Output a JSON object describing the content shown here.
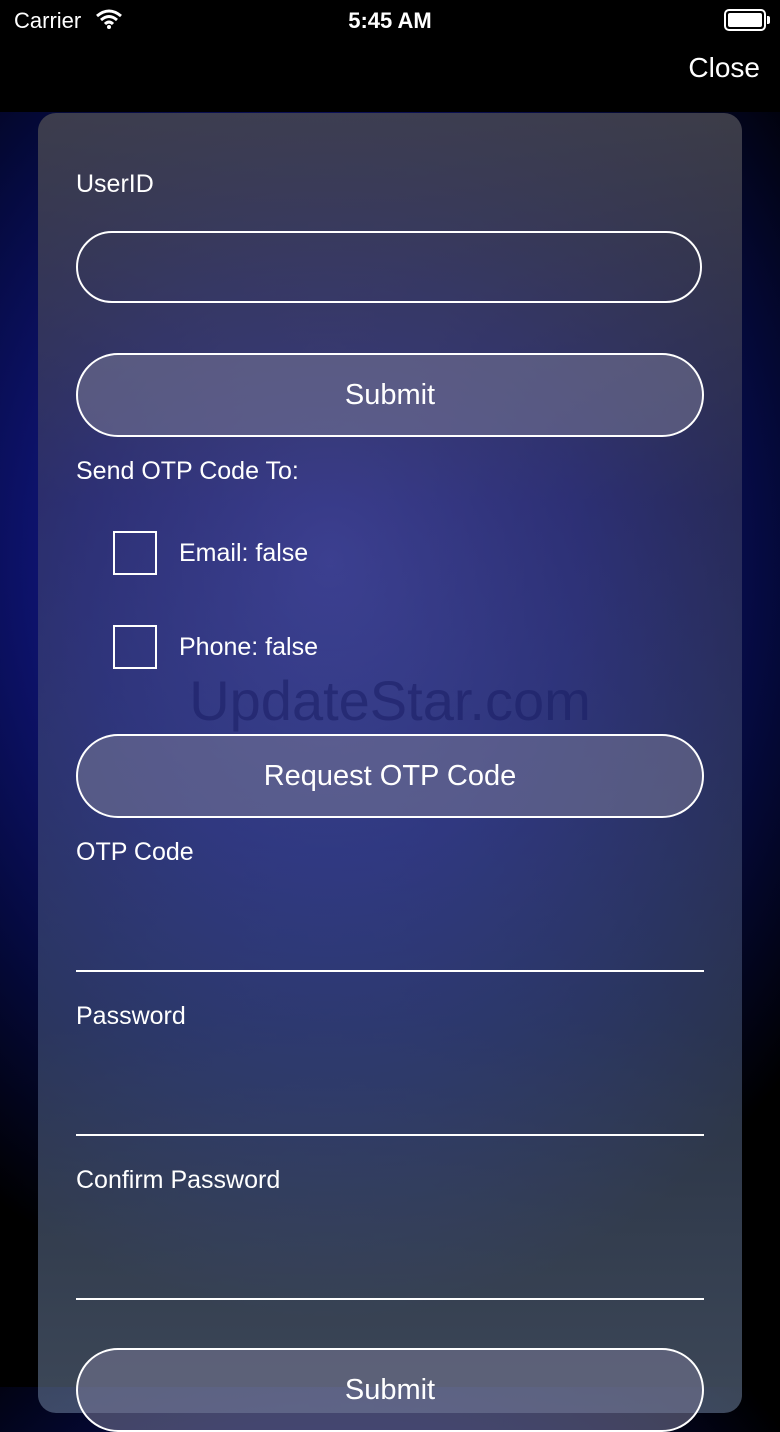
{
  "status_bar": {
    "carrier": "Carrier",
    "time": "5:45 AM"
  },
  "nav": {
    "close_label": "Close"
  },
  "form": {
    "userid_label": "UserID",
    "userid_value": "",
    "submit_label": "Submit",
    "send_otp_label": "Send OTP Code To:",
    "email_option": "Email: false",
    "phone_option": "Phone: false",
    "request_otp_label": "Request OTP Code",
    "otp_label": "OTP Code",
    "password_label": "Password",
    "confirm_password_label": "Confirm Password",
    "final_submit_label": "Submit"
  },
  "watermark": "UpdateStar.com"
}
